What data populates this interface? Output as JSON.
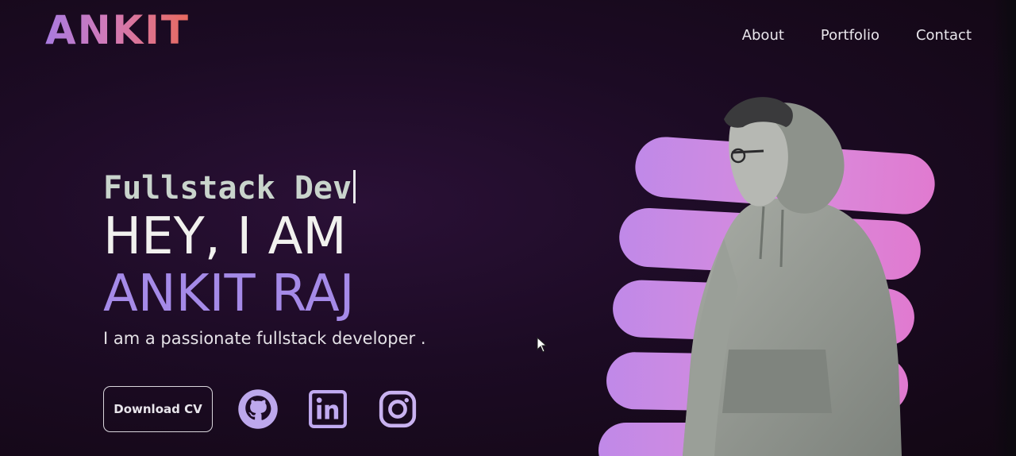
{
  "brand": {
    "logo_text": "ANKIT"
  },
  "nav": {
    "items": [
      "About",
      "Portfolio",
      "Contact"
    ]
  },
  "hero": {
    "typed_text": "Fullstack Dev",
    "greeting": "HEY, I AM",
    "name": "ANKIT RAJ",
    "tagline": "I am a passionate fullstack developer ."
  },
  "actions": {
    "download_cv_label": "Download CV"
  },
  "social": [
    {
      "icon": "github-icon"
    },
    {
      "icon": "linkedin-icon"
    },
    {
      "icon": "instagram-icon"
    }
  ],
  "colors": {
    "accent": "#a58ae8",
    "logo_gradient": [
      "#a97be0",
      "#e86a5e"
    ],
    "stripe_gradient": [
      "#b87fe0",
      "#e07ad0"
    ],
    "background": "#1c0b24"
  }
}
